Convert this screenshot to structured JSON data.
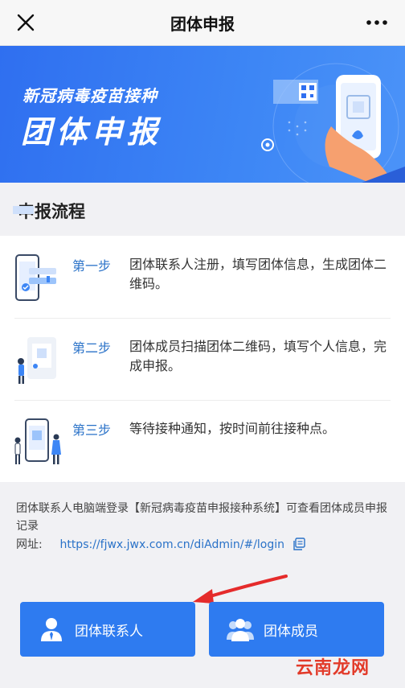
{
  "nav": {
    "title": "团体申报",
    "close_icon": "close-icon",
    "more_icon": "more-icon"
  },
  "banner": {
    "subtitle": "新冠病毒疫苗接种",
    "title": "团体申报"
  },
  "section": {
    "title": "申报流程"
  },
  "steps": [
    {
      "label": "第一步",
      "desc": "团体联系人注册，填写团体信息，生成团体二维码。"
    },
    {
      "label": "第二步",
      "desc": "团体成员扫描团体二维码，填写个人信息，完成申报。"
    },
    {
      "label": "第三步",
      "desc": "等待接种通知，按时间前往接种点。"
    }
  ],
  "note": {
    "text": "团体联系人电脑端登录【新冠病毒疫苗申报接种系统】可查看团体成员申报记录",
    "url_label": "网址:",
    "url": "https://fjwx.jwx.com.cn/diAdmin/#/login"
  },
  "buttons": {
    "contact": "团体联系人",
    "member": "团体成员"
  },
  "watermark": "云南龙网",
  "colors": {
    "accent": "#2e7bf0",
    "link": "#2a72c8",
    "arrow": "#e52b2b"
  }
}
